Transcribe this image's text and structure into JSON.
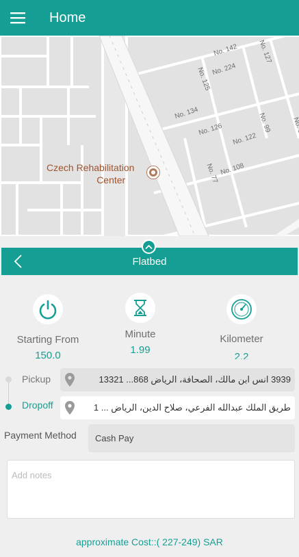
{
  "appbar": {
    "title": "Home"
  },
  "map": {
    "poi": {
      "line1": "Czech Rehabilitation",
      "line2": "Center"
    },
    "street_labels": [
      "No. 142",
      "No. 127",
      "No. 224",
      "No. 125",
      "No. 134",
      "No. 126",
      "No. 99",
      "No. 122",
      "No. 11",
      "No. 77",
      "No. 108"
    ]
  },
  "vehicle": {
    "title": "Flatbed"
  },
  "stats": [
    {
      "label": "Starting From",
      "value": "150.0",
      "icon": "power-icon"
    },
    {
      "label": "Minute",
      "value": "1.99",
      "icon": "hourglass-icon"
    },
    {
      "label": "Kilometer",
      "value": "2.2",
      "icon": "speedometer-icon"
    }
  ],
  "route": {
    "pickup": {
      "label": "Pickup",
      "address": "3939 انس ابن مالك، الصحافة، الرياض 868... 13321"
    },
    "dropoff": {
      "label": "Dropoff",
      "address": "طريق الملك عبدالله الفرعي، صلاح الدين، الرياض ... 1"
    }
  },
  "payment": {
    "label": "Payment Method",
    "value": "Cash Pay"
  },
  "notes": {
    "placeholder": "Add notes"
  },
  "cost": {
    "text": "approximate Cost::( 227-249) SAR"
  },
  "colors": {
    "primary": "#159e93",
    "pickup_dot": "#d8d8d8",
    "dropoff_dot": "#159e93"
  }
}
